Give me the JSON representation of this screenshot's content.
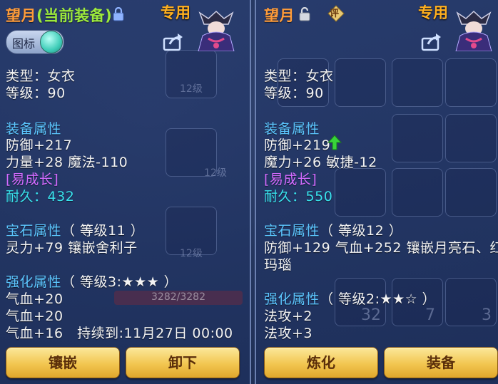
{
  "left": {
    "name": "望月",
    "current_tag": "(当前装备)",
    "special": "专用",
    "toggle_label": "图标",
    "type": "类型：女衣",
    "level": "等级：90",
    "equip_section": "装备属性",
    "stats": [
      "防御+217",
      "力量+28 魔法-110"
    ],
    "growth": "[易成长]",
    "durability_label": "耐久：",
    "durability": "432",
    "gem_section": "宝石属性",
    "gem_level": "（ 等级11 ）",
    "gem_text": "灵力+79 镶嵌舍利子",
    "enhance_section": "强化属性",
    "enhance_level": "（ 等级3:★★★ ）",
    "enhance_stats": [
      "气血+20",
      "气血+20",
      "气血+16　持续到:11月27日 00:00"
    ],
    "buttons": [
      "镶嵌",
      "卸下"
    ],
    "bg_texts": [
      "12级",
      "12级",
      "12级",
      "3282/3282"
    ]
  },
  "right": {
    "name": "望月",
    "badge": "评",
    "special": "专用",
    "type": "类型：女衣",
    "level": "等级：90",
    "equip_section": "装备属性",
    "stats": [
      "防御+219",
      "魔力+26 敏捷-12"
    ],
    "growth": "[易成长]",
    "durability_label": "耐久：",
    "durability": "550",
    "gem_section": "宝石属性",
    "gem_level": "（ 等级12 ）",
    "gem_text": "防御+129 气血+252 镶嵌月亮石、红",
    "gem_text2": "玛瑙",
    "enhance_section": "强化属性",
    "enhance_level": "（ 等级2:★★☆ ）",
    "enhance_stats": [
      "法攻+2",
      "法攻+3"
    ],
    "buttons": [
      "炼化",
      "装备"
    ],
    "bg_numbers": [
      "32",
      "7",
      "3"
    ]
  },
  "colors": {
    "title": "#ff9c3a",
    "current": "#9dea3c",
    "section": "#5cc6ff",
    "growth": "#d26bff",
    "durability": "#39e3ee",
    "stat_up_arrow": "#38d33a",
    "button": "#f2c650"
  }
}
